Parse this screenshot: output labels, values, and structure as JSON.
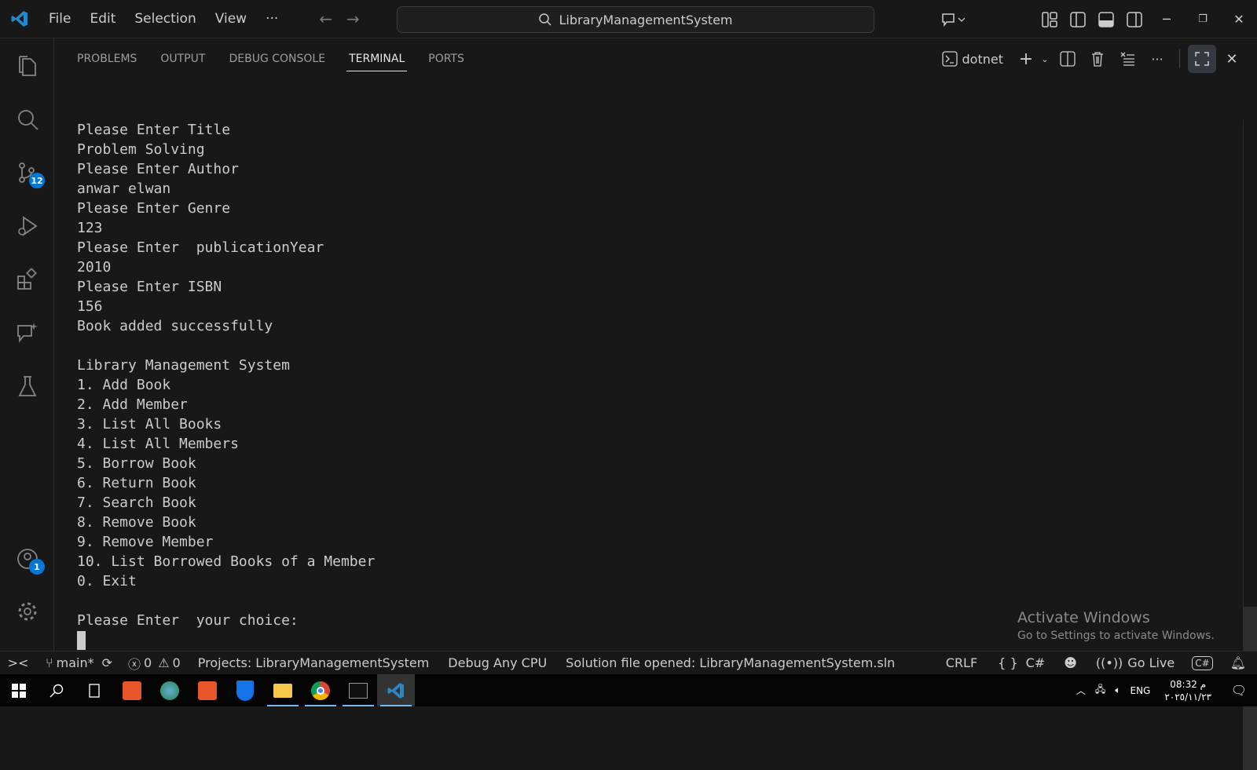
{
  "titlebar": {
    "menu": [
      "File",
      "Edit",
      "Selection",
      "View",
      "···"
    ],
    "search": "LibraryManagementSystem"
  },
  "activity": {
    "source_control_badge": "12",
    "accounts_badge": "1"
  },
  "panel": {
    "tabs": [
      "PROBLEMS",
      "OUTPUT",
      "DEBUG CONSOLE",
      "TERMINAL",
      "PORTS"
    ],
    "active_tab": "TERMINAL",
    "terminal_name": "dotnet"
  },
  "terminal": {
    "lines": [
      "Please Enter Title",
      "Problem Solving",
      "Please Enter Author",
      "anwar elwan",
      "Please Enter Genre",
      "123",
      "Please Enter  publicationYear",
      "2010",
      "Please Enter ISBN",
      "156",
      "Book added successfully",
      "",
      "Library Management System",
      "1. Add Book",
      "2. Add Member",
      "3. List All Books",
      "4. List All Members",
      "5. Borrow Book",
      "6. Return Book",
      "7. Search Book",
      "8. Remove Book",
      "9. Remove Member",
      "10. List Borrowed Books of a Member",
      "0. Exit",
      "",
      "Please Enter  your choice:"
    ]
  },
  "watermark": {
    "title": "Activate Windows",
    "subtitle": "Go to Settings to activate Windows."
  },
  "status": {
    "branch": "main*",
    "errors": "0",
    "warnings": "0",
    "projects": "Projects: LibraryManagementSystem",
    "config": "Debug Any CPU",
    "message": "Solution file opened: LibraryManagementSystem.sln",
    "eol": "CRLF",
    "lang_braces": "{ }",
    "language": "C#",
    "golive": "Go Live"
  },
  "taskbar": {
    "lang": "ENG",
    "time": "08:32 م",
    "date": "٢٠٢٥/١١/٢٣"
  },
  "colors": {
    "accent": "#0078d4",
    "background": "#181818"
  }
}
